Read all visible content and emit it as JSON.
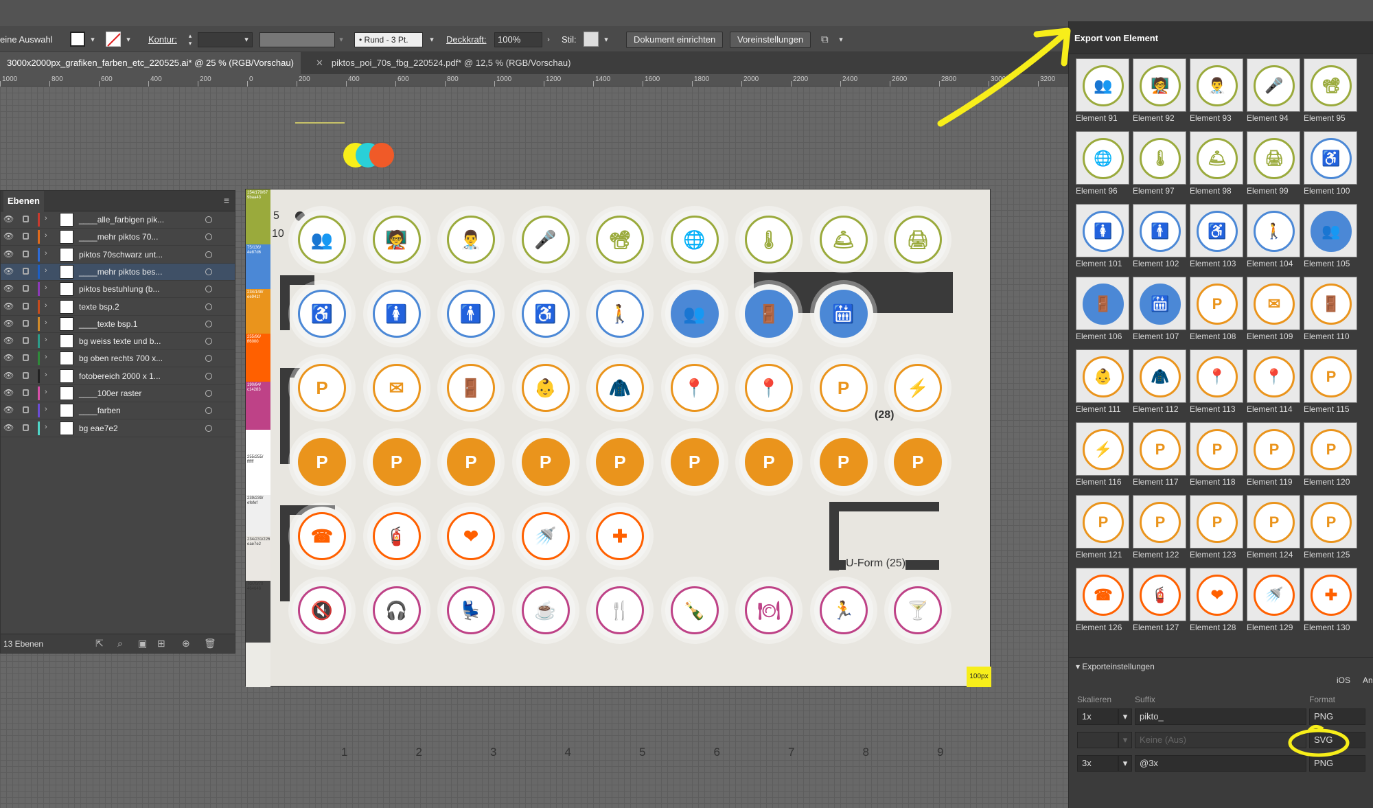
{
  "control_bar": {
    "selection_label": "eine Auswahl",
    "kontur_label": "Kontur:",
    "brush_label": "Rund - 3 Pt.",
    "opacity_label": "Deckkraft:",
    "opacity_value": "100%",
    "style_label": "Stil:",
    "doc_setup_button": "Dokument einrichten",
    "preferences_button": "Voreinstellungen"
  },
  "tabs": [
    {
      "label": "3000x2000px_grafiken_farben_etc_220525.ai* @ 25 % (RGB/Vorschau)"
    },
    {
      "label": "piktos_poi_70s_fbg_220524.pdf* @ 12,5 % (RGB/Vorschau)"
    }
  ],
  "ruler": [
    "1000",
    "800",
    "600",
    "400",
    "200",
    "0",
    "200",
    "400",
    "600",
    "800",
    "1000",
    "1200",
    "1400",
    "1600",
    "1800",
    "2000",
    "2200",
    "2400",
    "2600",
    "2800",
    "3000",
    "3200"
  ],
  "layers_panel": {
    "title": "Ebenen",
    "layers": [
      {
        "name": "____alle_farbigen pik...",
        "color": "#c83a2e"
      },
      {
        "name": "____mehr piktos 70...",
        "color": "#e06a1c"
      },
      {
        "name": "piktos 70schwarz unt...",
        "color": "#2e6bd6"
      },
      {
        "name": "____mehr piktos bes...",
        "color": "#1d5fc6"
      },
      {
        "name": "piktos bestuhlung (b...",
        "color": "#8c3ab8"
      },
      {
        "name": "texte bsp.2",
        "color": "#c74b1c"
      },
      {
        "name": "____texte bsp.1",
        "color": "#d08a2a"
      },
      {
        "name": "bg weiss texte und b...",
        "color": "#2c9c8a"
      },
      {
        "name": "bg oben rechts 700 x...",
        "color": "#2f8a3a"
      },
      {
        "name": "fotobereich 2000 x 1...",
        "color": "#222222"
      },
      {
        "name": "____100er raster",
        "color": "#d84fa8"
      },
      {
        "name": "____farben",
        "color": "#6a4cd6"
      },
      {
        "name": "bg eae7e2",
        "color": "#4fd6c8"
      }
    ],
    "count_label": "13 Ebenen"
  },
  "artboard": {
    "color_bands": [
      {
        "label": "154/179/67 9baa43",
        "color": "#9aaa3c"
      },
      {
        "label": "75/136/ 4e87d6",
        "color": "#4b88d6"
      },
      {
        "label": "234/148/ ee941f",
        "color": "#ea941c"
      },
      {
        "label": "255/96/ ff6000",
        "color": "#ff6000"
      },
      {
        "label": "190/64/ c14283",
        "color": "#be4287"
      },
      {
        "label": "",
        "color": "#ffffff"
      },
      {
        "label": "255/255/ ffffff",
        "color": "#ffffff"
      },
      {
        "label": "239/239/ efefef",
        "color": "#efefef"
      },
      {
        "label": "234/231/226 eae7e2",
        "color": "#eae7e2"
      },
      {
        "label": "70/70/70 464646",
        "color": "#464646"
      }
    ],
    "badge_5": "5",
    "badge_10": "10",
    "text_u_form": "U-Form (25)",
    "text_28": "(28)",
    "corner_label": "100px",
    "column_numbers": [
      "1",
      "2",
      "3",
      "4",
      "5",
      "6",
      "7",
      "8",
      "9"
    ],
    "rows": [
      {
        "color": "#9aaa3c",
        "icons": [
          "👥",
          "🧑‍🏫",
          "👨‍⚕️",
          "🎤",
          "📽",
          "🌐",
          "🌡",
          "🛎",
          "🖨"
        ]
      },
      {
        "color": "#4b88d6",
        "icons": [
          "♿",
          "🚺",
          "🚹",
          "♿",
          "🚶",
          "👥",
          "🚪",
          "🛗",
          ""
        ]
      },
      {
        "color": "#ea941c",
        "icons": [
          "P",
          "✉",
          "🚪",
          "👶",
          "🧥",
          "📍",
          "📍",
          "P",
          "⚡"
        ]
      },
      {
        "color": "#ea941c",
        "icons": [
          "P",
          "P",
          "P",
          "P",
          "P",
          "P",
          "P",
          "P",
          "P"
        ]
      },
      {
        "color": "#ff6000",
        "icons": [
          "☎",
          "🧯",
          "❤",
          "🚿",
          "✚",
          "",
          "",
          "",
          ""
        ]
      },
      {
        "color": "#be4287",
        "icons": [
          "🔇",
          "🎧",
          "💺",
          "☕",
          "🍴",
          "🍾",
          "🍽",
          "🏃",
          "🍸"
        ]
      }
    ]
  },
  "export_panel": {
    "title": "Export von Element",
    "elements": [
      {
        "label": "Element 91",
        "icon": "👥",
        "color": "#9aaa3c",
        "fill": false
      },
      {
        "label": "Element 92",
        "icon": "🧑‍🏫",
        "color": "#9aaa3c",
        "fill": false
      },
      {
        "label": "Element 93",
        "icon": "👨‍⚕️",
        "color": "#9aaa3c",
        "fill": false
      },
      {
        "label": "Element 94",
        "icon": "🎤",
        "color": "#9aaa3c",
        "fill": false
      },
      {
        "label": "Element 95",
        "icon": "📽",
        "color": "#9aaa3c",
        "fill": false
      },
      {
        "label": "Element 96",
        "icon": "🌐",
        "color": "#9aaa3c",
        "fill": false
      },
      {
        "label": "Element 97",
        "icon": "🌡",
        "color": "#9aaa3c",
        "fill": false
      },
      {
        "label": "Element 98",
        "icon": "🛎",
        "color": "#9aaa3c",
        "fill": false
      },
      {
        "label": "Element 99",
        "icon": "🖨",
        "color": "#9aaa3c",
        "fill": false
      },
      {
        "label": "Element 100",
        "icon": "♿",
        "color": "#4b88d6",
        "fill": false
      },
      {
        "label": "Element 101",
        "icon": "🚺",
        "color": "#4b88d6",
        "fill": false
      },
      {
        "label": "Element 102",
        "icon": "🚹",
        "color": "#4b88d6",
        "fill": false
      },
      {
        "label": "Element 103",
        "icon": "♿",
        "color": "#4b88d6",
        "fill": false
      },
      {
        "label": "Element 104",
        "icon": "🚶",
        "color": "#4b88d6",
        "fill": false
      },
      {
        "label": "Element 105",
        "icon": "👥",
        "color": "#4b88d6",
        "fill": true
      },
      {
        "label": "Element 106",
        "icon": "🚪",
        "color": "#4b88d6",
        "fill": true
      },
      {
        "label": "Element 107",
        "icon": "🛗",
        "color": "#4b88d6",
        "fill": true
      },
      {
        "label": "Element 108",
        "icon": "P",
        "color": "#ea941c",
        "fill": false
      },
      {
        "label": "Element 109",
        "icon": "✉",
        "color": "#ea941c",
        "fill": false
      },
      {
        "label": "Element 110",
        "icon": "🚪",
        "color": "#ea941c",
        "fill": false
      },
      {
        "label": "Element 111",
        "icon": "👶",
        "color": "#ea941c",
        "fill": false
      },
      {
        "label": "Element 112",
        "icon": "🧥",
        "color": "#ea941c",
        "fill": false
      },
      {
        "label": "Element 113",
        "icon": "📍",
        "color": "#ea941c",
        "fill": false
      },
      {
        "label": "Element 114",
        "icon": "📍",
        "color": "#ea941c",
        "fill": false
      },
      {
        "label": "Element 115",
        "icon": "P",
        "color": "#ea941c",
        "fill": false
      },
      {
        "label": "Element 116",
        "icon": "⚡",
        "color": "#ea941c",
        "fill": false
      },
      {
        "label": "Element 117",
        "icon": "P",
        "color": "#ea941c",
        "fill": false
      },
      {
        "label": "Element 118",
        "icon": "P",
        "color": "#ea941c",
        "fill": false
      },
      {
        "label": "Element 119",
        "icon": "P",
        "color": "#ea941c",
        "fill": false
      },
      {
        "label": "Element 120",
        "icon": "P",
        "color": "#ea941c",
        "fill": false
      },
      {
        "label": "Element 121",
        "icon": "P",
        "color": "#ea941c",
        "fill": false
      },
      {
        "label": "Element 122",
        "icon": "P",
        "color": "#ea941c",
        "fill": false
      },
      {
        "label": "Element 123",
        "icon": "P",
        "color": "#ea941c",
        "fill": false
      },
      {
        "label": "Element 124",
        "icon": "P",
        "color": "#ea941c",
        "fill": false
      },
      {
        "label": "Element 125",
        "icon": "P",
        "color": "#ea941c",
        "fill": false
      },
      {
        "label": "Element 126",
        "icon": "☎",
        "color": "#ff6000",
        "fill": false
      },
      {
        "label": "Element 127",
        "icon": "🧯",
        "color": "#ff6000",
        "fill": false
      },
      {
        "label": "Element 128",
        "icon": "❤",
        "color": "#ff6000",
        "fill": false
      },
      {
        "label": "Element 129",
        "icon": "🚿",
        "color": "#ff6000",
        "fill": false
      },
      {
        "label": "Element 130",
        "icon": "✚",
        "color": "#ff6000",
        "fill": false
      }
    ],
    "settings": {
      "title": "Exporteinstellungen",
      "ios_label": "iOS",
      "an_label": "An",
      "col_scale": "Skalieren",
      "col_suffix": "Suffix",
      "col_format": "Format",
      "row1": {
        "scale": "1x",
        "suffix": "pikto_",
        "format": "PNG"
      },
      "row2": {
        "scale": "",
        "suffix": "Keine (Aus)",
        "format": "SVG"
      },
      "row3": {
        "scale": "3x",
        "suffix": "@3x",
        "format": "PNG"
      }
    }
  },
  "annotation_color": "#f7ee1a"
}
